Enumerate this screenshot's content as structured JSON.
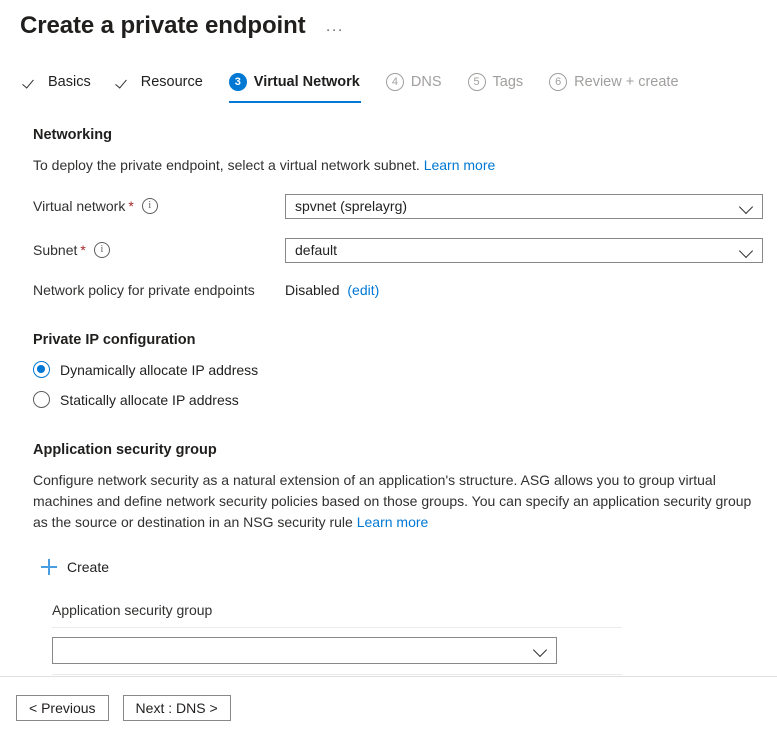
{
  "header": {
    "title": "Create a private endpoint",
    "ellipsis": "···"
  },
  "tabs": [
    {
      "id": "basics",
      "label": "Basics",
      "state": "done",
      "marker": "✓"
    },
    {
      "id": "resource",
      "label": "Resource",
      "state": "done",
      "marker": "✓"
    },
    {
      "id": "virtual-network",
      "label": "Virtual Network",
      "state": "active",
      "marker": "3"
    },
    {
      "id": "dns",
      "label": "DNS",
      "state": "pending",
      "marker": "4"
    },
    {
      "id": "tags",
      "label": "Tags",
      "state": "pending",
      "marker": "5"
    },
    {
      "id": "review-create",
      "label": "Review + create",
      "state": "pending",
      "marker": "6"
    }
  ],
  "networking": {
    "title": "Networking",
    "description": "To deploy the private endpoint, select a virtual network subnet.",
    "learn_more": "Learn more",
    "virtual_network": {
      "label": "Virtual network",
      "required_marker": "*",
      "info_icon": "i",
      "value": "spvnet (sprelayrg)"
    },
    "subnet": {
      "label": "Subnet",
      "required_marker": "*",
      "info_icon": "i",
      "value": "default"
    },
    "network_policy": {
      "label": "Network policy for private endpoints",
      "value": "Disabled",
      "edit_link": "(edit)"
    }
  },
  "private_ip": {
    "title": "Private IP configuration",
    "options": [
      {
        "id": "dynamic",
        "label": "Dynamically allocate IP address",
        "selected": true
      },
      {
        "id": "static",
        "label": "Statically allocate IP address",
        "selected": false
      }
    ]
  },
  "application_security_group": {
    "title": "Application security group",
    "description": "Configure network security as a natural extension of an application's structure. ASG allows you to group virtual machines and define network security policies based on those groups. You can specify an application security group as the source or destination in an NSG security rule",
    "learn_more": "Learn more",
    "create_button": "Create",
    "field_label": "Application security group",
    "field_value": "",
    "field_placeholder": ""
  },
  "footer": {
    "previous": "< Previous",
    "next": "Next : DNS >"
  },
  "colors": {
    "accent": "#0078d4",
    "link": "#0078d4",
    "required": "#a4262c",
    "text": "#201f1e",
    "muted": "#a19f9d",
    "border": "#8a8886"
  }
}
